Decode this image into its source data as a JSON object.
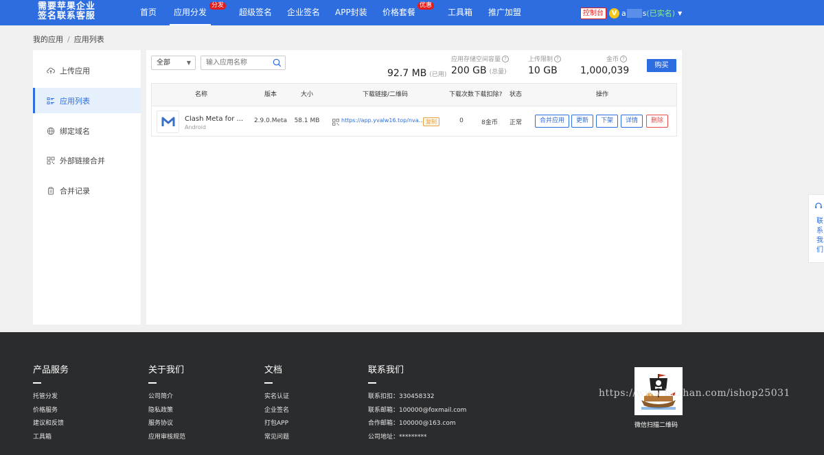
{
  "header": {
    "logo_line1": "需要苹果企业",
    "logo_line2": "签名联系客服",
    "nav": [
      {
        "label": "首页"
      },
      {
        "label": "应用分发",
        "badge": "分发"
      },
      {
        "label": "超级签名"
      },
      {
        "label": "企业签名"
      },
      {
        "label": "APP封装"
      },
      {
        "label": "价格套餐",
        "badge": "优惠"
      },
      {
        "label": "工具箱"
      },
      {
        "label": "推广加盟"
      }
    ],
    "console_label": "控制台",
    "user": {
      "level_badge": "V",
      "name_start": "a",
      "name_end": "s",
      "verified": "(已实名)"
    }
  },
  "breadcrumb": {
    "root": "我的应用",
    "separator": "/",
    "current": "应用列表"
  },
  "sidebar": {
    "items": [
      {
        "label": "上传应用",
        "icon": "cloud-upload-icon"
      },
      {
        "label": "应用列表",
        "icon": "list-icon"
      },
      {
        "label": "绑定域名",
        "icon": "globe-icon"
      },
      {
        "label": "外部链接合并",
        "icon": "qrcode-icon"
      },
      {
        "label": "合并记录",
        "icon": "clipboard-icon"
      }
    ]
  },
  "toolbar": {
    "filter_value": "全部",
    "search_placeholder": "输入应用名称",
    "buy_label": "购买"
  },
  "stats": {
    "used": {
      "value": "92.7 MB",
      "suffix": "(已用)"
    },
    "storage": {
      "label": "应用存储空间容量",
      "value": "200 GB",
      "suffix": "(总量)"
    },
    "upload_limit": {
      "label": "上传限制",
      "value": "10 GB"
    },
    "coins": {
      "label": "金币",
      "value": "1,000,039"
    }
  },
  "table": {
    "headers": [
      "名称",
      "版本",
      "大小",
      "下载链接/二维码",
      "下载次数",
      "下载扣除?",
      "状态",
      "操作"
    ],
    "rows": [
      {
        "name": "Clash Meta for ...",
        "platform": "Android",
        "version": "2.9.0.Meta",
        "size": "58.1 MB",
        "link": "https://app.yvalw16.top/nva...",
        "copy_label": "复制",
        "downloads": "0",
        "deduct": "8金币",
        "status": "正常",
        "actions": [
          "合并应用",
          "更新",
          "下架",
          "详情",
          "删除"
        ]
      }
    ]
  },
  "float_contact": {
    "label": "联系我们"
  },
  "footer": {
    "columns": [
      {
        "title": "产品服务",
        "links": [
          "托管分发",
          "价格服务",
          "建议和反馈",
          "工具箱"
        ]
      },
      {
        "title": "关于我们",
        "links": [
          "公司简介",
          "隐私政策",
          "服务协议",
          "应用审核规范"
        ]
      },
      {
        "title": "文档",
        "links": [
          "实名认证",
          "企业签名",
          "打包APP",
          "常见问题"
        ]
      },
      {
        "title": "联系我们",
        "links": [
          "联系扣扣：330458332",
          "联系邮箱：100000@foxmail.com",
          "合作邮箱：100000@163.com",
          "公司地址：*********"
        ]
      }
    ],
    "qr_caption": "微信扫描二维码",
    "watermark": "https://www.huzhan.com/ishop25031"
  },
  "colors": {
    "primary": "#2d6de0",
    "danger": "#e64b4b",
    "footer_bg": "#2b2c2e",
    "badge_red": "#e21b1b"
  }
}
